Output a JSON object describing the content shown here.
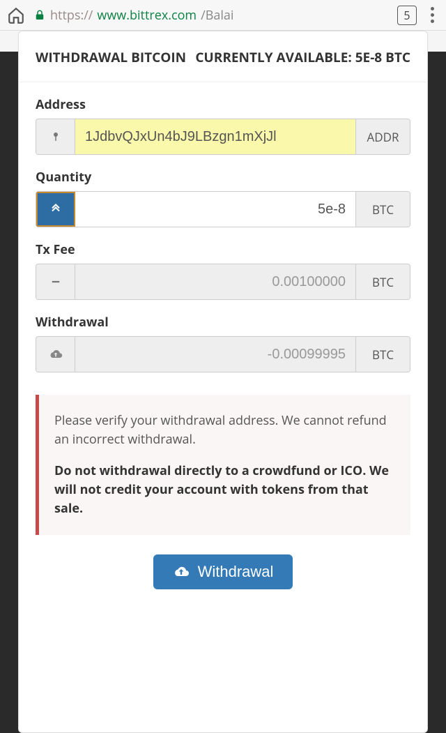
{
  "browser": {
    "url_scheme": "https://",
    "url_host": "www.bittrex.com",
    "url_path": "/Balai",
    "tab_count": "5"
  },
  "header": {
    "title_left": "WITHDRAWAL BITCOIN",
    "title_right": "CURRENTLY AVAILABLE: 5E-8 BTC"
  },
  "address": {
    "label": "Address",
    "value": "1JdbvQJxUn4bJ9LBzgn1mXjJl",
    "addon": "ADDR"
  },
  "quantity": {
    "label": "Quantity",
    "value": "5e-8",
    "addon": "BTC"
  },
  "txfee": {
    "label": "Tx Fee",
    "value": "0.00100000",
    "addon": "BTC"
  },
  "withdrawal": {
    "label": "Withdrawal",
    "value": "-0.00099995",
    "addon": "BTC"
  },
  "alert": {
    "line1": "Please verify your withdrawal address. We cannot refund an incorrect withdrawal.",
    "line2": "Do not withdrawal directly to a crowdfund or ICO. We will not credit your account with tokens from that sale."
  },
  "submit": {
    "label": "Withdrawal"
  }
}
